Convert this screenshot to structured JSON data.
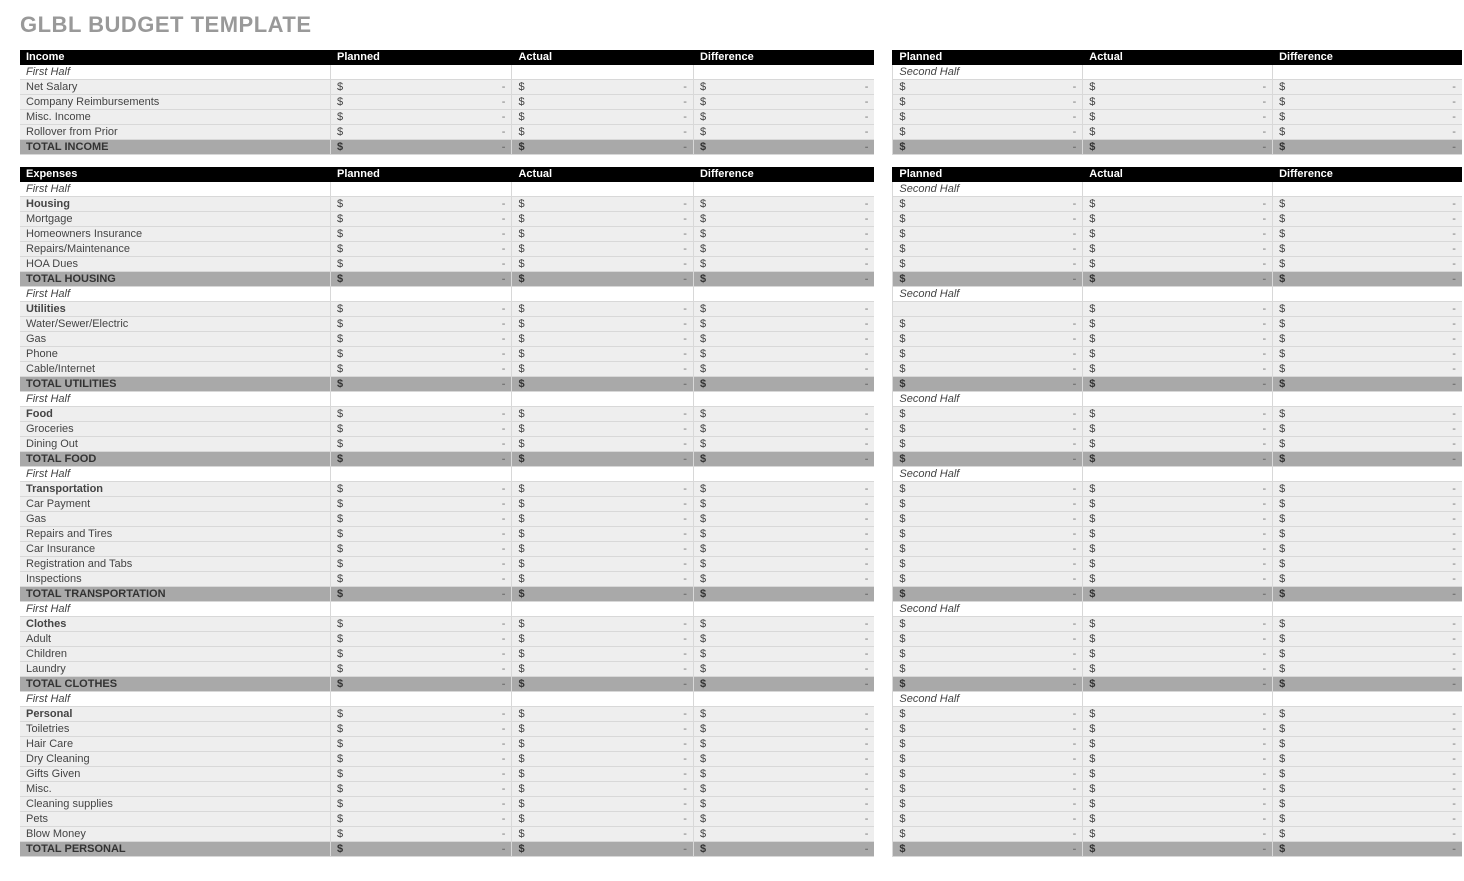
{
  "title": "GLBL BUDGET TEMPLATE",
  "cols": {
    "planned": "Planned",
    "actual": "Actual",
    "difference": "Difference"
  },
  "half": {
    "first": "First Half",
    "second": "Second Half"
  },
  "money": {
    "symbol": "$",
    "dash": "-"
  },
  "sections": [
    {
      "header": "Income",
      "rows": [
        {
          "type": "sect"
        },
        {
          "type": "item",
          "label": "Net Salary"
        },
        {
          "type": "item",
          "label": "Company Reimbursements"
        },
        {
          "type": "item",
          "label": "Misc. Income"
        },
        {
          "type": "item",
          "label": "Rollover from Prior"
        },
        {
          "type": "total",
          "label": "TOTAL INCOME"
        }
      ]
    },
    {
      "header": "Expenses",
      "rows": [
        {
          "type": "sect"
        },
        {
          "type": "bold",
          "label": "Housing"
        },
        {
          "type": "item",
          "label": "Mortgage"
        },
        {
          "type": "item",
          "label": "Homeowners Insurance"
        },
        {
          "type": "item",
          "label": "Repairs/Maintenance"
        },
        {
          "type": "item",
          "label": "HOA Dues"
        },
        {
          "type": "total",
          "label": "TOTAL HOUSING"
        },
        {
          "type": "sect"
        },
        {
          "type": "bold",
          "label": "Utilities",
          "rightFirstEmpty": true
        },
        {
          "type": "item",
          "label": "Water/Sewer/Electric"
        },
        {
          "type": "item",
          "label": "Gas"
        },
        {
          "type": "item",
          "label": "Phone"
        },
        {
          "type": "item",
          "label": "Cable/Internet"
        },
        {
          "type": "total",
          "label": "TOTAL UTILITIES"
        },
        {
          "type": "sect"
        },
        {
          "type": "bold",
          "label": "Food"
        },
        {
          "type": "item",
          "label": "Groceries"
        },
        {
          "type": "item",
          "label": "Dining Out"
        },
        {
          "type": "total",
          "label": "TOTAL FOOD"
        },
        {
          "type": "sect"
        },
        {
          "type": "bold",
          "label": "Transportation"
        },
        {
          "type": "item",
          "label": "Car Payment"
        },
        {
          "type": "item",
          "label": "Gas"
        },
        {
          "type": "item",
          "label": "Repairs and Tires"
        },
        {
          "type": "item",
          "label": "Car Insurance"
        },
        {
          "type": "item",
          "label": "Registration and Tabs"
        },
        {
          "type": "item",
          "label": "Inspections"
        },
        {
          "type": "total",
          "label": "TOTAL TRANSPORTATION"
        },
        {
          "type": "sect"
        },
        {
          "type": "bold",
          "label": "Clothes"
        },
        {
          "type": "item",
          "label": "Adult"
        },
        {
          "type": "item",
          "label": "Children"
        },
        {
          "type": "item",
          "label": "Laundry"
        },
        {
          "type": "total",
          "label": "TOTAL CLOTHES"
        },
        {
          "type": "sect"
        },
        {
          "type": "bold",
          "label": "Personal"
        },
        {
          "type": "item",
          "label": "Toiletries"
        },
        {
          "type": "item",
          "label": "Hair Care"
        },
        {
          "type": "item",
          "label": "Dry Cleaning"
        },
        {
          "type": "item",
          "label": "Gifts Given"
        },
        {
          "type": "item",
          "label": "Misc."
        },
        {
          "type": "item",
          "label": "Cleaning supplies"
        },
        {
          "type": "item",
          "label": "Pets"
        },
        {
          "type": "item",
          "label": "Blow Money"
        },
        {
          "type": "total",
          "label": "TOTAL PERSONAL"
        }
      ]
    }
  ]
}
